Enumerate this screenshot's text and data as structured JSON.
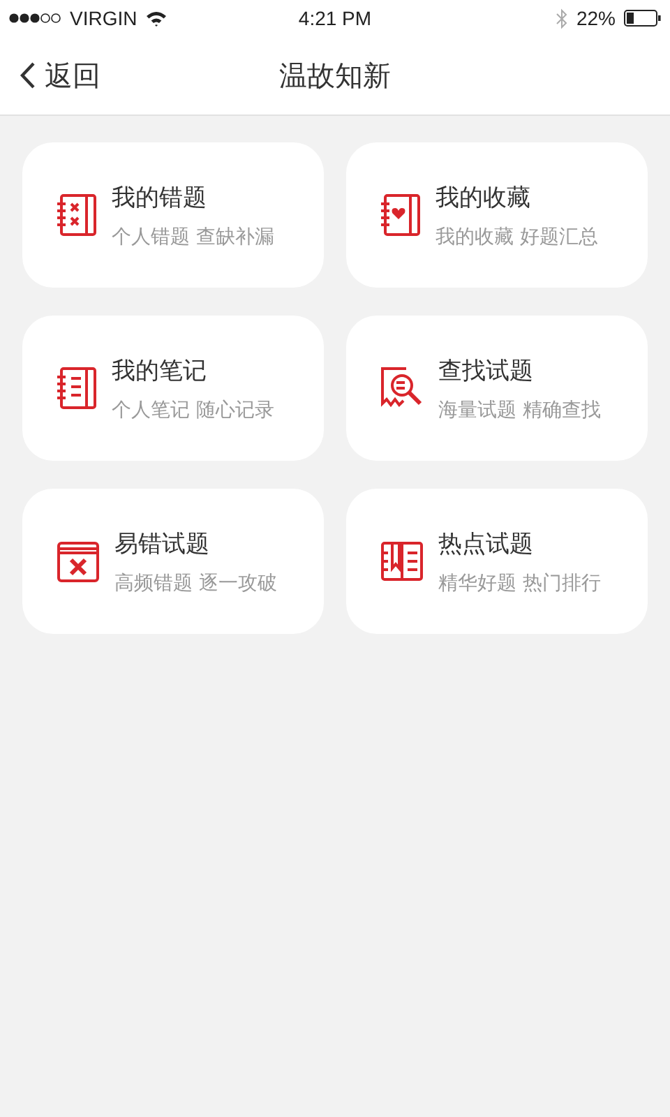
{
  "status_bar": {
    "carrier": "VIRGIN",
    "time": "4:21 PM",
    "battery": "22%"
  },
  "nav": {
    "back": "返回",
    "title": "温故知新"
  },
  "cards": [
    {
      "kind": "notebook-cross",
      "title": "我的错题",
      "subtitle": "个人错题 查缺补漏"
    },
    {
      "kind": "notebook-heart",
      "title": "我的收藏",
      "subtitle": "我的收藏 好题汇总"
    },
    {
      "kind": "notebook-lines",
      "title": "我的笔记",
      "subtitle": "个人笔记 随心记录"
    },
    {
      "kind": "search-doc",
      "title": "查找试题",
      "subtitle": "海量试题 精确查找"
    },
    {
      "kind": "book-cross",
      "title": "易错试题",
      "subtitle": "高频错题 逐一攻破"
    },
    {
      "kind": "book-bookmark",
      "title": "热点试题",
      "subtitle": "精华好题 热门排行"
    }
  ]
}
